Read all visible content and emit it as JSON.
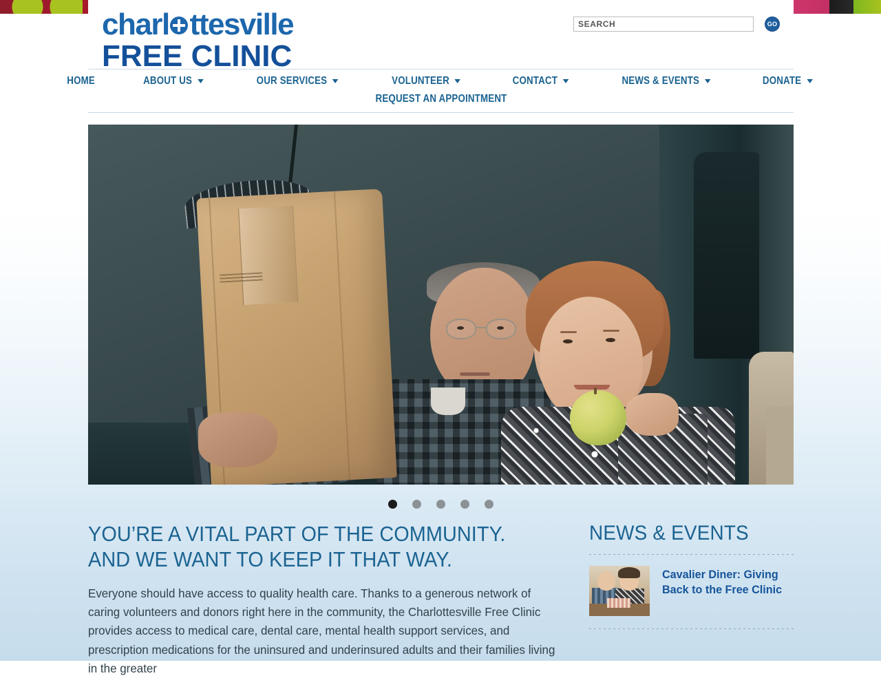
{
  "site": {
    "logo_line1": "charlottesville",
    "logo_line2": "FREE CLINIC",
    "logo_icon": "medical-cross-icon"
  },
  "search": {
    "placeholder": "SEARCH",
    "value": "",
    "go_label": "GO"
  },
  "nav": {
    "primary": [
      {
        "label": "HOME",
        "has_dropdown": false
      },
      {
        "label": "ABOUT US",
        "has_dropdown": true
      },
      {
        "label": "OUR SERVICES",
        "has_dropdown": true
      },
      {
        "label": "VOLUNTEER",
        "has_dropdown": true
      },
      {
        "label": "CONTACT",
        "has_dropdown": true
      },
      {
        "label": "NEWS & EVENTS",
        "has_dropdown": true
      },
      {
        "label": "DONATE",
        "has_dropdown": true
      }
    ],
    "secondary": [
      {
        "label": "REQUEST AN APPOINTMENT",
        "has_dropdown": false
      }
    ]
  },
  "hero": {
    "alt": "Older couple standing beside a dark teal car; man holds a brown paper grocery bag, woman holds an apple",
    "carousel": {
      "slide_count": 5,
      "active_index": 0,
      "dots": [
        "1",
        "2",
        "3",
        "4",
        "5"
      ]
    }
  },
  "main": {
    "headline_line1": "YOU’RE A VITAL PART OF THE COMMUNITY.",
    "headline_line2": "AND WE WANT TO KEEP IT THAT WAY.",
    "body": "Everyone should have access to quality health care. Thanks to a generous network of caring volunteers and donors right here in the community, the Charlottesville Free Clinic provides access to medical care, dental care, mental health support services, and prescription medications for the uninsured and underinsured adults and their families living in the greater"
  },
  "sidebar": {
    "title": "NEWS & EVENTS",
    "items": [
      {
        "headline": "Cavalier Diner: Giving Back to the Free Clinic",
        "thumb_alt": "Two people standing behind a table at the Cavalier Diner"
      }
    ]
  },
  "colors": {
    "brand_blue": "#1d67ad",
    "nav_blue": "#1b6391",
    "link_blue": "#17559a",
    "body_text": "#31424b",
    "page_gradient_top": "#ffffff",
    "page_gradient_bottom": "#c6dcec",
    "divider": "#7ba5c4",
    "dot_active": "#1b1b1b",
    "dot_inactive": "#8b9296"
  }
}
